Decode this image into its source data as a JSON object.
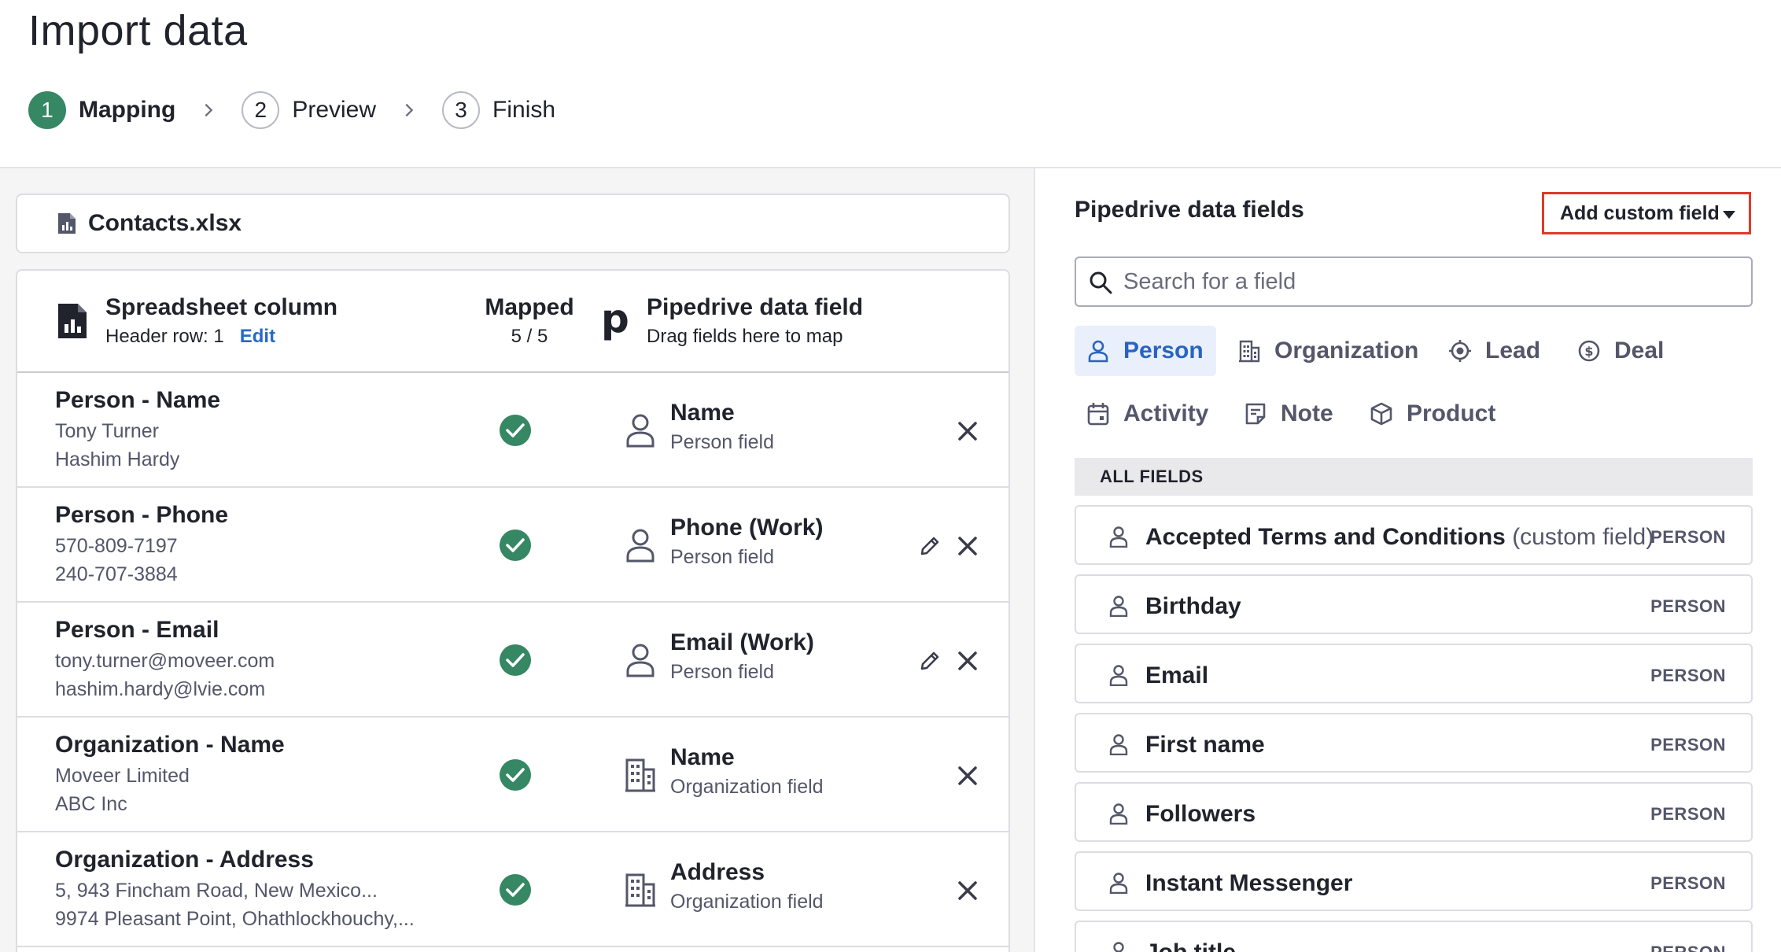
{
  "page": {
    "title": "Import data"
  },
  "stepper": [
    {
      "num": "1",
      "label": "Mapping",
      "active": true
    },
    {
      "num": "2",
      "label": "Preview",
      "active": false
    },
    {
      "num": "3",
      "label": "Finish",
      "active": false
    }
  ],
  "file": {
    "name": "Contacts.xlsx"
  },
  "mapping": {
    "col_title": "Spreadsheet column",
    "header_row": "Header row: 1",
    "edit_label": "Edit",
    "mapped_title": "Mapped",
    "mapped_count": "5 / 5",
    "logo_letter": "p",
    "pd_title": "Pipedrive data field",
    "pd_sub": "Drag fields here to map",
    "rows": [
      {
        "column": "Person - Name",
        "sample1": "Tony Turner",
        "sample2": "Hashim Hardy",
        "field": "Name",
        "field_type": "Person field",
        "icon": "person-icon",
        "editable": false
      },
      {
        "column": "Person - Phone",
        "sample1": "570-809-7197",
        "sample2": "240-707-3884",
        "field": "Phone (Work)",
        "field_type": "Person field",
        "icon": "person-icon",
        "editable": true
      },
      {
        "column": "Person - Email",
        "sample1": "tony.turner@moveer.com",
        "sample2": "hashim.hardy@lvie.com",
        "field": "Email (Work)",
        "field_type": "Person field",
        "icon": "person-icon",
        "editable": true
      },
      {
        "column": "Organization - Name",
        "sample1": "Moveer Limited",
        "sample2": "ABC Inc",
        "field": "Name",
        "field_type": "Organization field",
        "icon": "building-icon",
        "editable": false
      },
      {
        "column": "Organization - Address",
        "sample1": "5, 943 Fincham Road, New Mexico...",
        "sample2": "9974 Pleasant Point, Ohathlockhouchy,...",
        "field": "Address",
        "field_type": "Organization field",
        "icon": "building-icon",
        "editable": false
      }
    ]
  },
  "right_panel": {
    "title": "Pipedrive data fields",
    "add_custom_label": "Add custom field",
    "search_placeholder": "Search for a field",
    "tabs": [
      {
        "label": "Person",
        "icon": "person-icon",
        "active": true
      },
      {
        "label": "Organization",
        "icon": "building-icon",
        "active": false
      },
      {
        "label": "Lead",
        "icon": "target-icon",
        "active": false
      },
      {
        "label": "Deal",
        "icon": "dollar-icon",
        "active": false
      },
      {
        "label": "Activity",
        "icon": "calendar-icon",
        "active": false
      },
      {
        "label": "Note",
        "icon": "note-icon",
        "active": false
      },
      {
        "label": "Product",
        "icon": "box-icon",
        "active": false
      }
    ],
    "all_fields_label": "ALL FIELDS",
    "fields": [
      {
        "name": "Accepted Terms and Conditions",
        "extra": "(custom field)",
        "type": "PERSON"
      },
      {
        "name": "Birthday",
        "extra": "",
        "type": "PERSON"
      },
      {
        "name": "Email",
        "extra": "",
        "type": "PERSON"
      },
      {
        "name": "First name",
        "extra": "",
        "type": "PERSON"
      },
      {
        "name": "Followers",
        "extra": "",
        "type": "PERSON"
      },
      {
        "name": "Instant Messenger",
        "extra": "",
        "type": "PERSON"
      },
      {
        "name": "Job title",
        "extra": "",
        "type": "PERSON"
      }
    ]
  },
  "colors": {
    "accent_green": "#368764",
    "link_blue": "#2869c9",
    "highlight_red": "#e0392b",
    "active_tab_bg": "#e9f0fb"
  }
}
